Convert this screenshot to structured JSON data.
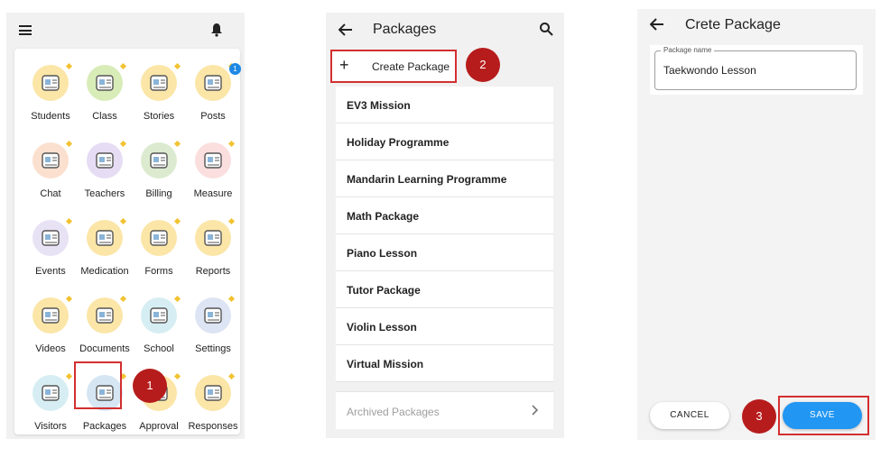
{
  "screen1": {
    "tiles": [
      {
        "label": "Students",
        "icon": "student-id-card-icon",
        "bg": "#fbe6a8"
      },
      {
        "label": "Class",
        "icon": "class-board-icon",
        "bg": "#d8ecb8"
      },
      {
        "label": "Stories",
        "icon": "photo-stack-icon",
        "bg": "#fbe6a8"
      },
      {
        "label": "Posts",
        "icon": "megaphone-icon",
        "bg": "#fbe6a8",
        "badge": "1"
      },
      {
        "label": "Chat",
        "icon": "chat-bubbles-icon",
        "bg": "#fbe0cf"
      },
      {
        "label": "Teachers",
        "icon": "teacher-avatar-icon",
        "bg": "#e6dcf3"
      },
      {
        "label": "Billing",
        "icon": "receipt-icon",
        "bg": "#dcebd0"
      },
      {
        "label": "Measure",
        "icon": "scale-gauge-icon",
        "bg": "#fbdede"
      },
      {
        "label": "Events",
        "icon": "calendar-icon",
        "bg": "#e8e2f5"
      },
      {
        "label": "Medication",
        "icon": "nurse-icon",
        "bg": "#fbe6a8"
      },
      {
        "label": "Forms",
        "icon": "form-list-icon",
        "bg": "#fbe6a8"
      },
      {
        "label": "Reports",
        "icon": "report-search-icon",
        "bg": "#fbe6a8"
      },
      {
        "label": "Videos",
        "icon": "video-player-icon",
        "bg": "#fbe6a8"
      },
      {
        "label": "Documents",
        "icon": "folder-icon",
        "bg": "#fbe6a8"
      },
      {
        "label": "School",
        "icon": "school-building-icon",
        "bg": "#d6eef3"
      },
      {
        "label": "Settings",
        "icon": "settings-cog-icon",
        "bg": "#dde4f3"
      },
      {
        "label": "Visitors",
        "icon": "visitor-avatar-icon",
        "bg": "#d6eef3"
      },
      {
        "label": "Packages",
        "icon": "package-user-icon",
        "bg": "#d6e6f3"
      },
      {
        "label": "Approval",
        "icon": "approval-icon",
        "bg": "#fbe6a8"
      },
      {
        "label": "Responses",
        "icon": "responses-network-icon",
        "bg": "#fbe6a8"
      }
    ],
    "step_label": "1"
  },
  "screen2": {
    "title": "Packages",
    "create_label": "Create Package",
    "create_plus": "+",
    "step_label": "2",
    "items": [
      "EV3 Mission",
      "Holiday Programme",
      "Mandarin Learning Programme",
      "Math Package",
      "Piano Lesson",
      "Tutor Package",
      "Violin Lesson",
      "Virtual Mission"
    ],
    "archived_label": "Archived Packages"
  },
  "screen3": {
    "title": "Crete Package",
    "field_label": "Package name",
    "field_value": "Taekwondo Lesson",
    "cancel_label": "CANCEL",
    "save_label": "SAVE",
    "step_label": "3"
  },
  "colors": {
    "accent": "#2196f3",
    "highlight": "#d32f2f",
    "step": "#b71c1c"
  }
}
